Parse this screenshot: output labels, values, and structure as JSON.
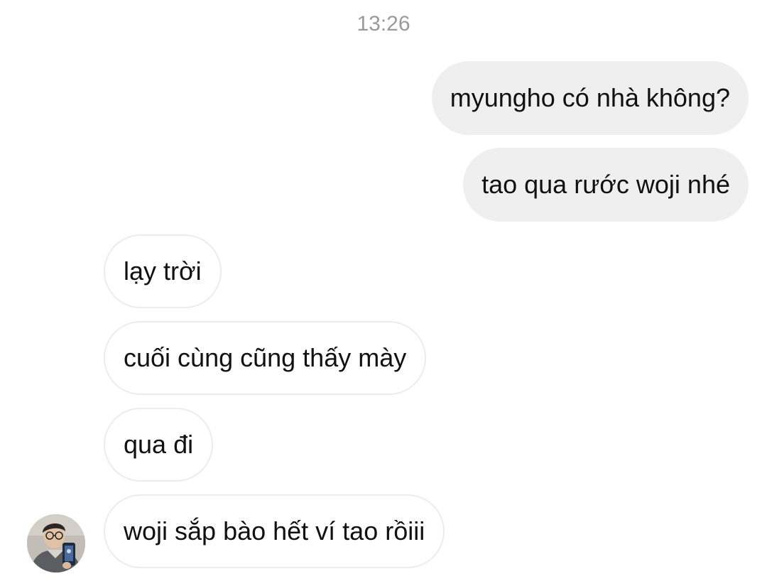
{
  "conversation": {
    "timestamp": "13:26",
    "outgoing": [
      {
        "text": "myungho có nhà không?"
      },
      {
        "text": "tao qua rước woji nhé"
      }
    ],
    "incoming": [
      {
        "text": "lạy trời"
      },
      {
        "text": "cuối cùng cũng thấy mày"
      },
      {
        "text": "qua đi"
      },
      {
        "text": "woji sắp bào hết ví tao rồiii"
      }
    ]
  },
  "colors": {
    "outgoing_bubble": "#efefef",
    "incoming_border": "#ececec",
    "timestamp_text": "#9a9a9a"
  }
}
